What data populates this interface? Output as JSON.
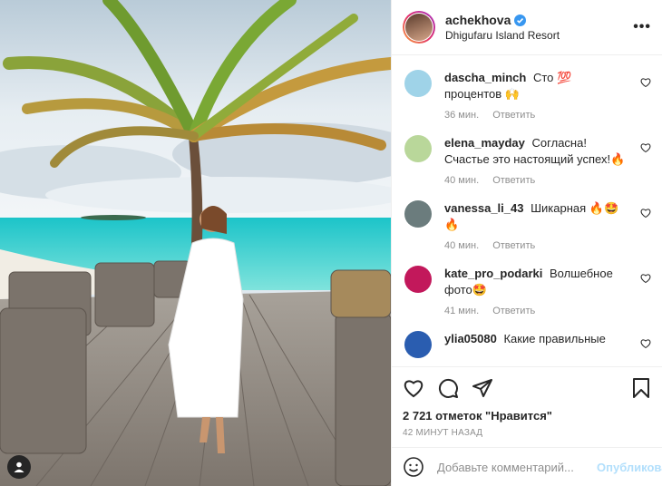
{
  "post": {
    "username": "achekhova",
    "verified": true,
    "location": "Dhigufaru Island Resort",
    "more_label": "•••",
    "more_icon": "more-options-icon",
    "tag_icon": "user-tag-icon"
  },
  "comments": [
    {
      "user": "dascha_minch",
      "text": "Сто 💯 процентов 🙌",
      "time": "36 мин.",
      "reply": "Ответить",
      "avatar_color": "#9fd3e8"
    },
    {
      "user": "elena_mayday",
      "text": "Согласна! Счастье это настоящий успех!🔥",
      "time": "40 мин.",
      "reply": "Ответить",
      "avatar_color": "#b9d79a"
    },
    {
      "user": "vanessa_li_43",
      "text": "Шикарная 🔥🤩🔥",
      "time": "40 мин.",
      "reply": "Ответить",
      "avatar_color": "#6b7c7d"
    },
    {
      "user": "kate_pro_podarki",
      "text": "Волшебное фото🤩",
      "time": "41 мин.",
      "reply": "Ответить",
      "avatar_color": "#c2185b"
    },
    {
      "user": "ylia05080",
      "text": "Какие правильные",
      "time": "",
      "reply": "",
      "avatar_color": "#2a5db0"
    }
  ],
  "actions": {
    "like_icon": "heart-icon",
    "comment_icon": "comment-icon",
    "share_icon": "share-icon",
    "save_icon": "bookmark-icon"
  },
  "likes_text": "2 721 отметок \"Нравится\"",
  "time_ago": "42 минут назад",
  "comment_input": {
    "placeholder": "Добавьте комментарий...",
    "value": "",
    "publish_label": "Опубликовать"
  },
  "colors": {
    "publish_disabled": "#b2dffc",
    "meta_gray": "#8e8e8e",
    "border": "#efefef",
    "verified_blue": "#3897f0"
  }
}
